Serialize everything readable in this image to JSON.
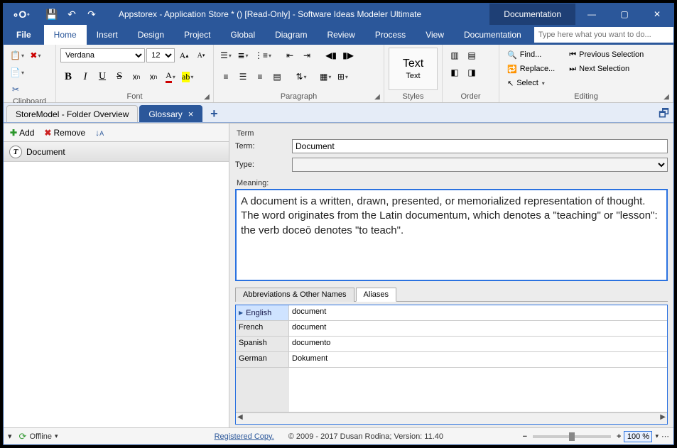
{
  "titlebar": {
    "title": "Appstorex - Application Store * () [Read-Only] - Software Ideas Modeler Ultimate",
    "doc_pill": "Documentation"
  },
  "menu": {
    "tabs": [
      "File",
      "Home",
      "Insert",
      "Design",
      "Project",
      "Global",
      "Diagram",
      "Review",
      "Process",
      "View",
      "Documentation"
    ],
    "active": "Home",
    "search_placeholder": "Type here what you want to do..."
  },
  "ribbon": {
    "clipboard_label": "Clipboard",
    "font_label": "Font",
    "paragraph_label": "Paragraph",
    "styles_label": "Styles",
    "order_label": "Order",
    "editing_label": "Editing",
    "font_name": "Verdana",
    "font_size": "12",
    "text_btn_main": "Text",
    "text_btn_sub": "Text",
    "find": "Find...",
    "replace": "Replace...",
    "select": "Select",
    "prev_sel": "Previous Selection",
    "next_sel": "Next Selection"
  },
  "doctabs": {
    "tab1": "StoreModel - Folder Overview",
    "tab2": "Glossary"
  },
  "left": {
    "add": "Add",
    "remove": "Remove",
    "term0": "Document"
  },
  "form": {
    "section": "Term",
    "term_label": "Term:",
    "term_value": "Document",
    "type_label": "Type:",
    "type_value": "",
    "meaning_label": "Meaning:",
    "meaning_value": "A document is a written, drawn, presented, or memorialized representation of thought. The word originates from the Latin documentum, which denotes a \"teaching\" or \"lesson\": the verb doceō denotes \"to teach\"."
  },
  "subtabs": {
    "t1": "Abbreviations & Other Names",
    "t2": "Aliases"
  },
  "aliases": [
    {
      "lang": "English",
      "val": "document"
    },
    {
      "lang": "French",
      "val": "document"
    },
    {
      "lang": "Spanish",
      "val": "documento"
    },
    {
      "lang": "German",
      "val": "Dokument"
    }
  ],
  "status": {
    "offline": "Offline",
    "registered": "Registered Copy.",
    "copyright": "© 2009 - 2017 Dusan Rodina; Version: 11.40",
    "zoom": "100 %"
  }
}
